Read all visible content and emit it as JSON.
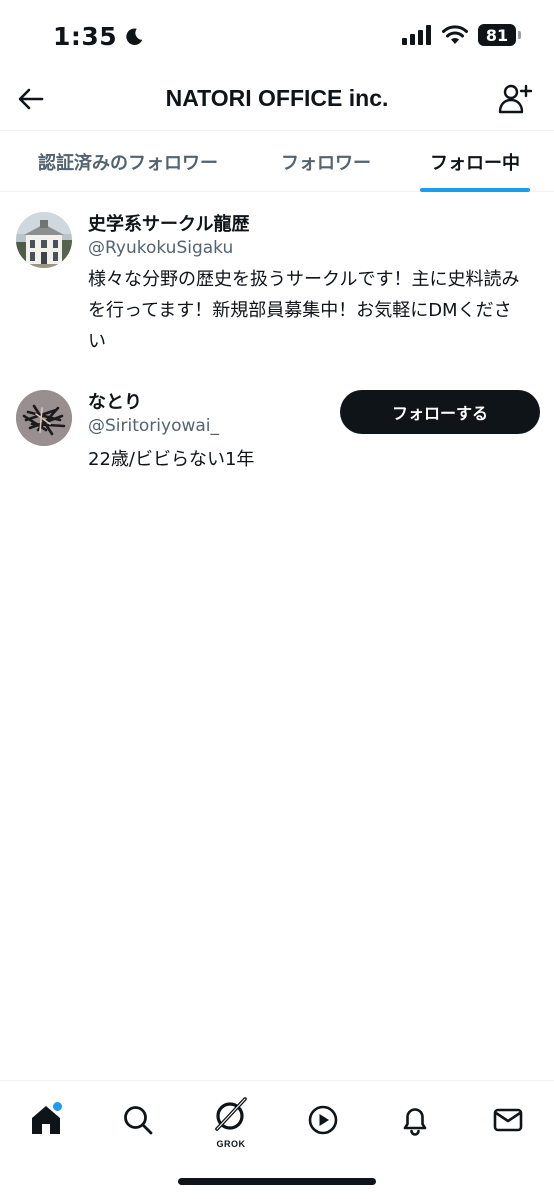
{
  "status_bar": {
    "time": "1:35",
    "battery": "81"
  },
  "header": {
    "title": "NATORI OFFICE inc."
  },
  "tabs": [
    {
      "label": "認証済みのフォロワー",
      "active": false
    },
    {
      "label": "フォロワー",
      "active": false
    },
    {
      "label": "フォロー中",
      "active": true
    }
  ],
  "users": [
    {
      "name": "史学系サークル龍歴",
      "handle": "@RyukokuSigaku",
      "bio": "様々な分野の歴史を扱うサークルです！主に史料読みを行ってます！新規部員募集中！お気軽にDMください",
      "avatar_icon": "building-photo"
    },
    {
      "name": "なとり",
      "handle": "@Siritoriyowai_",
      "bio": "22歳/ビビらない1年",
      "follow_label": "フォローする",
      "avatar_icon": "scribble-photo"
    }
  ],
  "bottom_nav": {
    "grok_label": "GROK",
    "items": [
      "home-icon",
      "search-icon",
      "grok-icon",
      "video-icon",
      "notifications-icon",
      "messages-icon"
    ]
  },
  "colors": {
    "accent": "#1d9bf0",
    "text_primary": "#0f1419",
    "text_secondary": "#536471"
  }
}
